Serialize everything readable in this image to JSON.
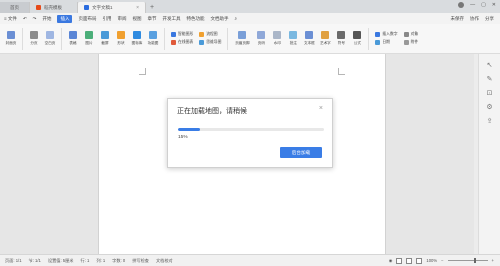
{
  "titlebar": {
    "tabs": [
      {
        "label": "首页"
      },
      {
        "label": "稻壳模板"
      },
      {
        "label": "文字文稿1"
      }
    ],
    "new_tab": "+",
    "tab_close": "×"
  },
  "menubar": {
    "file": "≡ 文件",
    "items": [
      "开始",
      "插入",
      "页面布局",
      "引用",
      "审阅",
      "视图",
      "章节",
      "开发工具",
      "特色功能",
      "文档助手"
    ],
    "active": "插入",
    "right": [
      "未保存",
      "协作",
      "分享"
    ]
  },
  "toolbar": {
    "tools": [
      "封面页",
      "分页",
      "空白页",
      "表格",
      "图片",
      "截屏",
      "形状",
      "图标库",
      "功能图",
      "智能图形",
      "在线图表",
      "流程图",
      "思维导图",
      "在线脑图",
      "页眉页脚",
      "页码",
      "水印",
      "批注",
      "文本框",
      "艺术字",
      "符号",
      "公式"
    ],
    "right_items": [
      "插入数字",
      "对象",
      "日期",
      "附件"
    ]
  },
  "dialog": {
    "title": "正在加载地图，请稍候",
    "close": "×",
    "progress": 0.15,
    "percent_label": "15%",
    "button": "后台加载"
  },
  "statusbar": {
    "items": [
      "页面: 1/1",
      "节: 1/1",
      "设置值: 5厘米",
      "行: 1",
      "列: 1",
      "字数: 0",
      "拼写检查",
      "文档校对"
    ],
    "zoom": "100%"
  },
  "colors": {
    "accent": "#3a7de6",
    "menu_active": "#3a78e0"
  }
}
